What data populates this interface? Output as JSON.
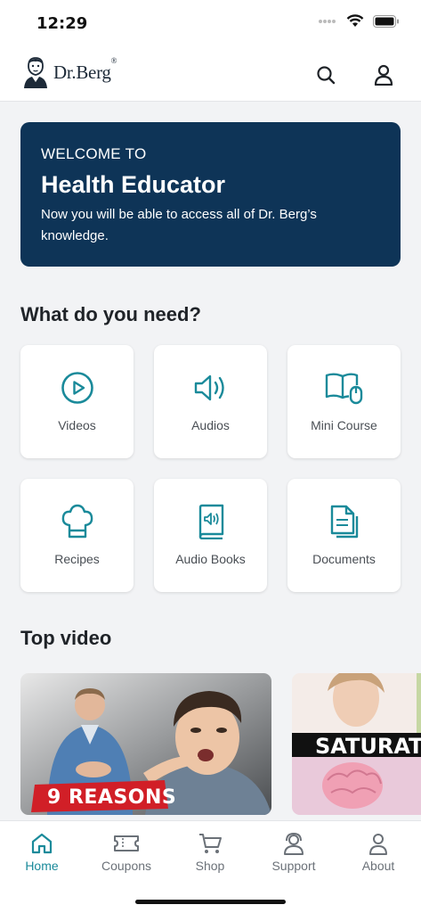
{
  "status": {
    "time": "12:29"
  },
  "header": {
    "brand": "Dr.Berg",
    "brand_mark": "®"
  },
  "welcome": {
    "kicker": "WELCOME TO",
    "title": "Health Educator",
    "text": "Now you will be able to access all of Dr. Berg’s knowledge."
  },
  "needs": {
    "title": "What do you need?",
    "items": [
      {
        "label": "Videos",
        "icon": "play-circle-icon"
      },
      {
        "label": "Audios",
        "icon": "speaker-icon"
      },
      {
        "label": "Mini Course",
        "icon": "book-mouse-icon"
      },
      {
        "label": "Recipes",
        "icon": "chef-hat-icon"
      },
      {
        "label": "Audio Books",
        "icon": "audio-book-icon"
      },
      {
        "label": "Documents",
        "icon": "documents-icon"
      }
    ]
  },
  "top_video": {
    "title": "Top video",
    "items": [
      {
        "overlay_text": "9 REASONS"
      },
      {
        "overlay_text": "SATURAT"
      }
    ]
  },
  "tabbar": {
    "tabs": [
      {
        "label": "Home",
        "icon": "home-icon",
        "active": true
      },
      {
        "label": "Coupons",
        "icon": "ticket-icon",
        "active": false
      },
      {
        "label": "Shop",
        "icon": "cart-icon",
        "active": false
      },
      {
        "label": "Support",
        "icon": "support-agent-icon",
        "active": false
      },
      {
        "label": "About",
        "icon": "person-icon",
        "active": false
      }
    ]
  },
  "colors": {
    "accent": "#1a8a9a",
    "banner": "#0e3457",
    "background": "#f2f3f5"
  }
}
